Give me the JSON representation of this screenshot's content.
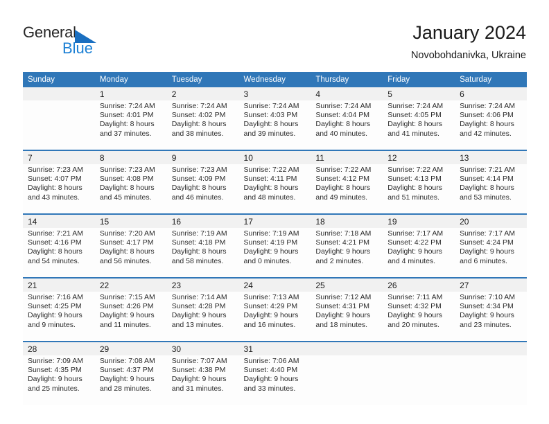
{
  "brand": {
    "name_part1": "General",
    "name_part2": "Blue",
    "triangle_color": "#1a6fc0",
    "text_color": "#262626",
    "blue_color": "#1a7fd4"
  },
  "header": {
    "title": "January 2024",
    "subtitle": "Novobohdanivka, Ukraine"
  },
  "theme": {
    "header_blue": "#3077b8",
    "daynum_band": "#f1f1f1",
    "cell_background": "#fdfdfd",
    "text_color": "#2b2b2b"
  },
  "calendar": {
    "weekday_headers": [
      "Sunday",
      "Monday",
      "Tuesday",
      "Wednesday",
      "Thursday",
      "Friday",
      "Saturday"
    ],
    "weeks": [
      {
        "days": [
          {
            "num": "",
            "sunrise": "",
            "sunset": "",
            "daylight1": "",
            "daylight2": ""
          },
          {
            "num": "1",
            "sunrise": "Sunrise: 7:24 AM",
            "sunset": "Sunset: 4:01 PM",
            "daylight1": "Daylight: 8 hours",
            "daylight2": "and 37 minutes."
          },
          {
            "num": "2",
            "sunrise": "Sunrise: 7:24 AM",
            "sunset": "Sunset: 4:02 PM",
            "daylight1": "Daylight: 8 hours",
            "daylight2": "and 38 minutes."
          },
          {
            "num": "3",
            "sunrise": "Sunrise: 7:24 AM",
            "sunset": "Sunset: 4:03 PM",
            "daylight1": "Daylight: 8 hours",
            "daylight2": "and 39 minutes."
          },
          {
            "num": "4",
            "sunrise": "Sunrise: 7:24 AM",
            "sunset": "Sunset: 4:04 PM",
            "daylight1": "Daylight: 8 hours",
            "daylight2": "and 40 minutes."
          },
          {
            "num": "5",
            "sunrise": "Sunrise: 7:24 AM",
            "sunset": "Sunset: 4:05 PM",
            "daylight1": "Daylight: 8 hours",
            "daylight2": "and 41 minutes."
          },
          {
            "num": "6",
            "sunrise": "Sunrise: 7:24 AM",
            "sunset": "Sunset: 4:06 PM",
            "daylight1": "Daylight: 8 hours",
            "daylight2": "and 42 minutes."
          }
        ]
      },
      {
        "days": [
          {
            "num": "7",
            "sunrise": "Sunrise: 7:23 AM",
            "sunset": "Sunset: 4:07 PM",
            "daylight1": "Daylight: 8 hours",
            "daylight2": "and 43 minutes."
          },
          {
            "num": "8",
            "sunrise": "Sunrise: 7:23 AM",
            "sunset": "Sunset: 4:08 PM",
            "daylight1": "Daylight: 8 hours",
            "daylight2": "and 45 minutes."
          },
          {
            "num": "9",
            "sunrise": "Sunrise: 7:23 AM",
            "sunset": "Sunset: 4:09 PM",
            "daylight1": "Daylight: 8 hours",
            "daylight2": "and 46 minutes."
          },
          {
            "num": "10",
            "sunrise": "Sunrise: 7:22 AM",
            "sunset": "Sunset: 4:11 PM",
            "daylight1": "Daylight: 8 hours",
            "daylight2": "and 48 minutes."
          },
          {
            "num": "11",
            "sunrise": "Sunrise: 7:22 AM",
            "sunset": "Sunset: 4:12 PM",
            "daylight1": "Daylight: 8 hours",
            "daylight2": "and 49 minutes."
          },
          {
            "num": "12",
            "sunrise": "Sunrise: 7:22 AM",
            "sunset": "Sunset: 4:13 PM",
            "daylight1": "Daylight: 8 hours",
            "daylight2": "and 51 minutes."
          },
          {
            "num": "13",
            "sunrise": "Sunrise: 7:21 AM",
            "sunset": "Sunset: 4:14 PM",
            "daylight1": "Daylight: 8 hours",
            "daylight2": "and 53 minutes."
          }
        ]
      },
      {
        "days": [
          {
            "num": "14",
            "sunrise": "Sunrise: 7:21 AM",
            "sunset": "Sunset: 4:16 PM",
            "daylight1": "Daylight: 8 hours",
            "daylight2": "and 54 minutes."
          },
          {
            "num": "15",
            "sunrise": "Sunrise: 7:20 AM",
            "sunset": "Sunset: 4:17 PM",
            "daylight1": "Daylight: 8 hours",
            "daylight2": "and 56 minutes."
          },
          {
            "num": "16",
            "sunrise": "Sunrise: 7:19 AM",
            "sunset": "Sunset: 4:18 PM",
            "daylight1": "Daylight: 8 hours",
            "daylight2": "and 58 minutes."
          },
          {
            "num": "17",
            "sunrise": "Sunrise: 7:19 AM",
            "sunset": "Sunset: 4:19 PM",
            "daylight1": "Daylight: 9 hours",
            "daylight2": "and 0 minutes."
          },
          {
            "num": "18",
            "sunrise": "Sunrise: 7:18 AM",
            "sunset": "Sunset: 4:21 PM",
            "daylight1": "Daylight: 9 hours",
            "daylight2": "and 2 minutes."
          },
          {
            "num": "19",
            "sunrise": "Sunrise: 7:17 AM",
            "sunset": "Sunset: 4:22 PM",
            "daylight1": "Daylight: 9 hours",
            "daylight2": "and 4 minutes."
          },
          {
            "num": "20",
            "sunrise": "Sunrise: 7:17 AM",
            "sunset": "Sunset: 4:24 PM",
            "daylight1": "Daylight: 9 hours",
            "daylight2": "and 6 minutes."
          }
        ]
      },
      {
        "days": [
          {
            "num": "21",
            "sunrise": "Sunrise: 7:16 AM",
            "sunset": "Sunset: 4:25 PM",
            "daylight1": "Daylight: 9 hours",
            "daylight2": "and 9 minutes."
          },
          {
            "num": "22",
            "sunrise": "Sunrise: 7:15 AM",
            "sunset": "Sunset: 4:26 PM",
            "daylight1": "Daylight: 9 hours",
            "daylight2": "and 11 minutes."
          },
          {
            "num": "23",
            "sunrise": "Sunrise: 7:14 AM",
            "sunset": "Sunset: 4:28 PM",
            "daylight1": "Daylight: 9 hours",
            "daylight2": "and 13 minutes."
          },
          {
            "num": "24",
            "sunrise": "Sunrise: 7:13 AM",
            "sunset": "Sunset: 4:29 PM",
            "daylight1": "Daylight: 9 hours",
            "daylight2": "and 16 minutes."
          },
          {
            "num": "25",
            "sunrise": "Sunrise: 7:12 AM",
            "sunset": "Sunset: 4:31 PM",
            "daylight1": "Daylight: 9 hours",
            "daylight2": "and 18 minutes."
          },
          {
            "num": "26",
            "sunrise": "Sunrise: 7:11 AM",
            "sunset": "Sunset: 4:32 PM",
            "daylight1": "Daylight: 9 hours",
            "daylight2": "and 20 minutes."
          },
          {
            "num": "27",
            "sunrise": "Sunrise: 7:10 AM",
            "sunset": "Sunset: 4:34 PM",
            "daylight1": "Daylight: 9 hours",
            "daylight2": "and 23 minutes."
          }
        ]
      },
      {
        "days": [
          {
            "num": "28",
            "sunrise": "Sunrise: 7:09 AM",
            "sunset": "Sunset: 4:35 PM",
            "daylight1": "Daylight: 9 hours",
            "daylight2": "and 25 minutes."
          },
          {
            "num": "29",
            "sunrise": "Sunrise: 7:08 AM",
            "sunset": "Sunset: 4:37 PM",
            "daylight1": "Daylight: 9 hours",
            "daylight2": "and 28 minutes."
          },
          {
            "num": "30",
            "sunrise": "Sunrise: 7:07 AM",
            "sunset": "Sunset: 4:38 PM",
            "daylight1": "Daylight: 9 hours",
            "daylight2": "and 31 minutes."
          },
          {
            "num": "31",
            "sunrise": "Sunrise: 7:06 AM",
            "sunset": "Sunset: 4:40 PM",
            "daylight1": "Daylight: 9 hours",
            "daylight2": "and 33 minutes."
          },
          {
            "num": "",
            "sunrise": "",
            "sunset": "",
            "daylight1": "",
            "daylight2": ""
          },
          {
            "num": "",
            "sunrise": "",
            "sunset": "",
            "daylight1": "",
            "daylight2": ""
          },
          {
            "num": "",
            "sunrise": "",
            "sunset": "",
            "daylight1": "",
            "daylight2": ""
          }
        ]
      }
    ]
  }
}
